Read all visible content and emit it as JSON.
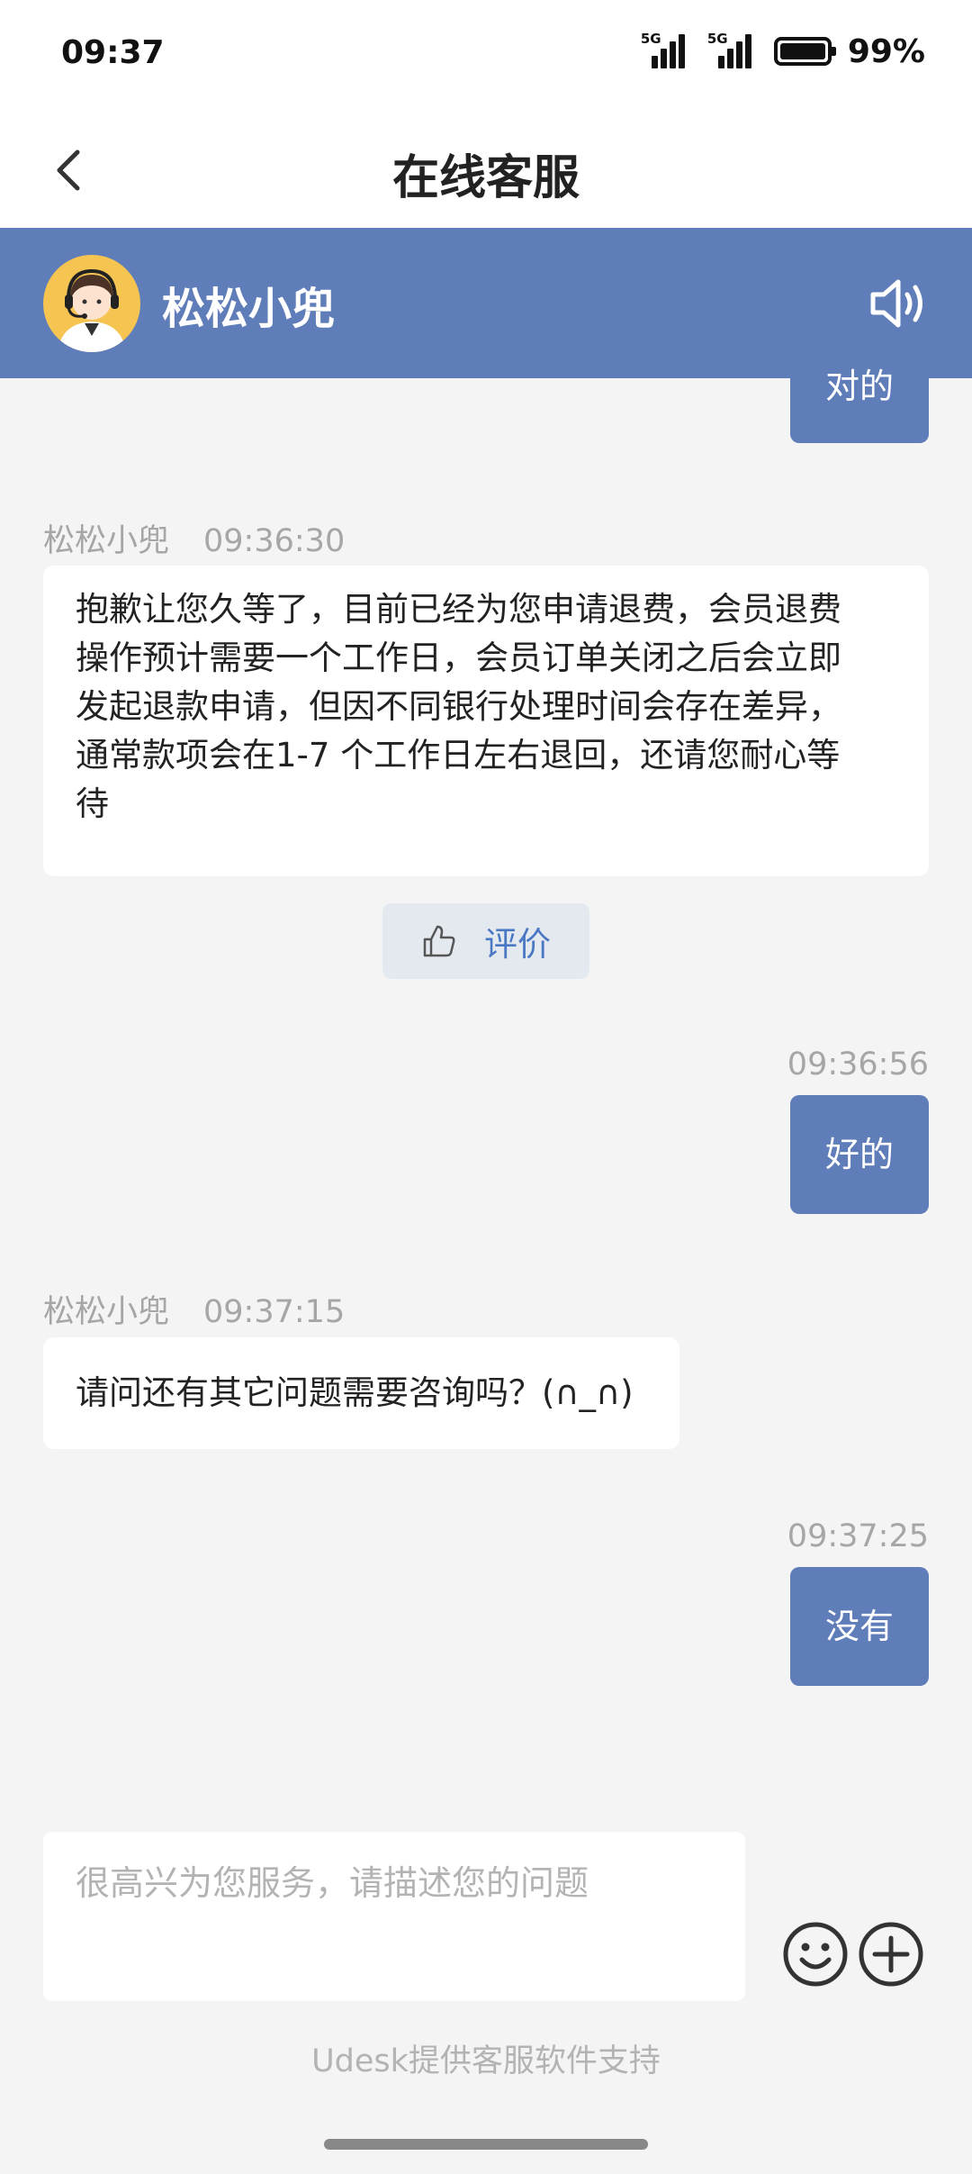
{
  "status_bar": {
    "time": "09:37",
    "battery": "99%",
    "battery_level": 0.99,
    "signal_tag_1": "5G",
    "signal_tag_2": "5G"
  },
  "nav": {
    "title": "在线客服"
  },
  "agent": {
    "name": "松松小兜"
  },
  "messages": [
    {
      "side": "right",
      "text": "对的"
    },
    {
      "side": "left",
      "sender": "松松小兜",
      "time": "09:36:30",
      "lines": [
        "抱歉让您久等了，目前已经为您申请退费，会员退费",
        "操作预计需要一个工作日，会员订单关闭之后会立即",
        "发起退款申请，但因不同银行处理时间会存在差异，",
        "通常款项会在1-7 个工作日左右退回，还请您耐心等",
        "待"
      ]
    },
    {
      "side": "right",
      "time": "09:36:56",
      "text": "好的"
    },
    {
      "side": "left",
      "sender": "松松小兜",
      "time": "09:37:15",
      "lines": [
        "请问还有其它问题需要咨询吗？(∩_∩)"
      ]
    },
    {
      "side": "right",
      "time": "09:37:25",
      "text": "没有"
    }
  ],
  "rate": {
    "label": "评价"
  },
  "input": {
    "placeholder": "很高兴为您服务，请描述您的问题"
  },
  "footer": {
    "text": "Udesk提供客服软件支持"
  },
  "icons": [
    "back-icon",
    "speaker-icon",
    "thumbs-up-icon",
    "emoji-icon",
    "plus-icon"
  ],
  "colors": {
    "accent": "#5f7db8",
    "link": "#4a78c3",
    "background": "#f4f4f4"
  }
}
